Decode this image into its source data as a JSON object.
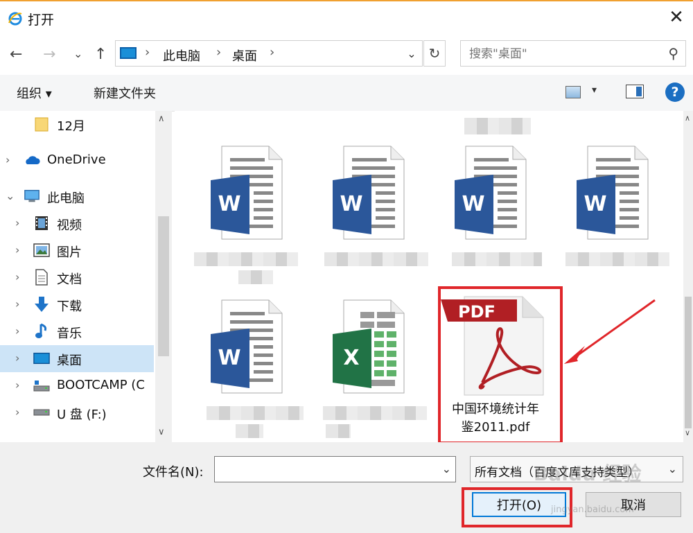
{
  "window": {
    "title": "打开",
    "close_glyph": "✕"
  },
  "nav": {
    "back": "←",
    "forward": "→",
    "recent": "⌄",
    "up": "↑",
    "refresh": "↻"
  },
  "address": {
    "crumbs": [
      "此电脑",
      "桌面"
    ],
    "sep": "›",
    "dropdown": "⌄"
  },
  "search": {
    "placeholder": "搜索\"桌面\"",
    "icon": "⚲"
  },
  "toolbar": {
    "organize": "组织 ▾",
    "new_folder": "新建文件夹",
    "view_dd": "▾",
    "help": "?"
  },
  "sidebar": {
    "items": [
      {
        "label": "12月",
        "icon": "folder-icon"
      },
      {
        "label": "OneDrive",
        "icon": "cloud-icon"
      },
      {
        "label": "此电脑",
        "icon": "computer-icon"
      },
      {
        "label": "视频",
        "icon": "video-icon"
      },
      {
        "label": "图片",
        "icon": "picture-icon"
      },
      {
        "label": "文档",
        "icon": "document-icon"
      },
      {
        "label": "下载",
        "icon": "download-icon"
      },
      {
        "label": "音乐",
        "icon": "music-icon"
      },
      {
        "label": "桌面",
        "icon": "desktop-icon"
      },
      {
        "label": "BOOTCAMP (C",
        "icon": "drive-icon"
      },
      {
        "label": "U 盘 (F:)",
        "icon": "usb-drive-icon"
      }
    ],
    "selected": "桌面",
    "chev_right": "›",
    "chev_down": "⌄",
    "scroll_up": "∧",
    "scroll_down": "∨"
  },
  "files": [
    {
      "type": "word",
      "letter": "W"
    },
    {
      "type": "word",
      "letter": "W"
    },
    {
      "type": "word",
      "letter": "W"
    },
    {
      "type": "word",
      "letter": "W"
    },
    {
      "type": "word",
      "letter": "W"
    },
    {
      "type": "excel",
      "letter": "X"
    },
    {
      "type": "pdf",
      "badge": "PDF",
      "name_line1": "中国环境统计年",
      "name_line2": "鉴2011.pdf"
    }
  ],
  "bottom": {
    "filename_label": "文件名(N):",
    "filename_value": "",
    "filetype": "所有文档（百度文库支持类型）",
    "open": "打开(O)",
    "cancel": "取消"
  },
  "watermark": {
    "main": "Baidu 经验",
    "sub": "jingyan.baidu.com"
  },
  "colors": {
    "accent": "#0078d7",
    "highlight": "#e0262a",
    "word": "#2b579a",
    "excel": "#217346",
    "pdf": "#b11f24"
  }
}
